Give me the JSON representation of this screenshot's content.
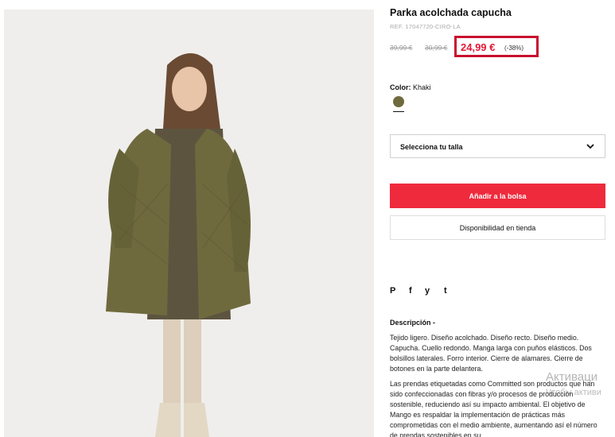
{
  "product": {
    "title": "Parka acolchada capucha",
    "ref": "REF. 17047720-CIRO-LA",
    "price_original_1": "39,99 €",
    "price_original_2": "30,99 €",
    "price_current": "24,99 €",
    "discount": "(-38%)"
  },
  "color": {
    "label": "Color:",
    "value": "Khaki",
    "swatch_hex": "#6f6a3e"
  },
  "size_select": {
    "label": "Selecciona tu talla",
    "icon": "chevron-down-icon"
  },
  "buttons": {
    "add_to_bag": "Añadir a la bolsa",
    "store_availability": "Disponibilidad en tienda"
  },
  "share": {
    "icons": [
      "pinterest-icon",
      "facebook-icon",
      "twitter-icon",
      "tumblr-icon"
    ],
    "pinterest": "P",
    "facebook": "f",
    "twitter": "y",
    "tumblr": "t"
  },
  "description": {
    "title": "Descripción -",
    "paragraph_1": "Tejido ligero. Diseño acolchado. Diseño recto. Diseño medio. Capucha. Cuello redondo. Manga larga con puños elásticos. Dos bolsillos laterales. Forro interior. Cierre de alamares. Cierre de botones en la parte delantera.",
    "paragraph_2": "Las prendas etiquetadas como Committed son productos que han sido confeccionadas con fibras y/o procesos de producción sostenible, reduciendo así su impacto ambiental. El objetivo de Mango es respaldar la implementación de prácticas más comprometidas con el medio ambiente, aumentando así el número de prendas sostenibles en su"
  },
  "os_watermark": {
    "line1": "Активаци",
    "line2": "Чтобы активи"
  },
  "colors": {
    "accent_red": "#ef2a3d",
    "price_red": "#e51937",
    "highlight_border": "#c8102e"
  }
}
